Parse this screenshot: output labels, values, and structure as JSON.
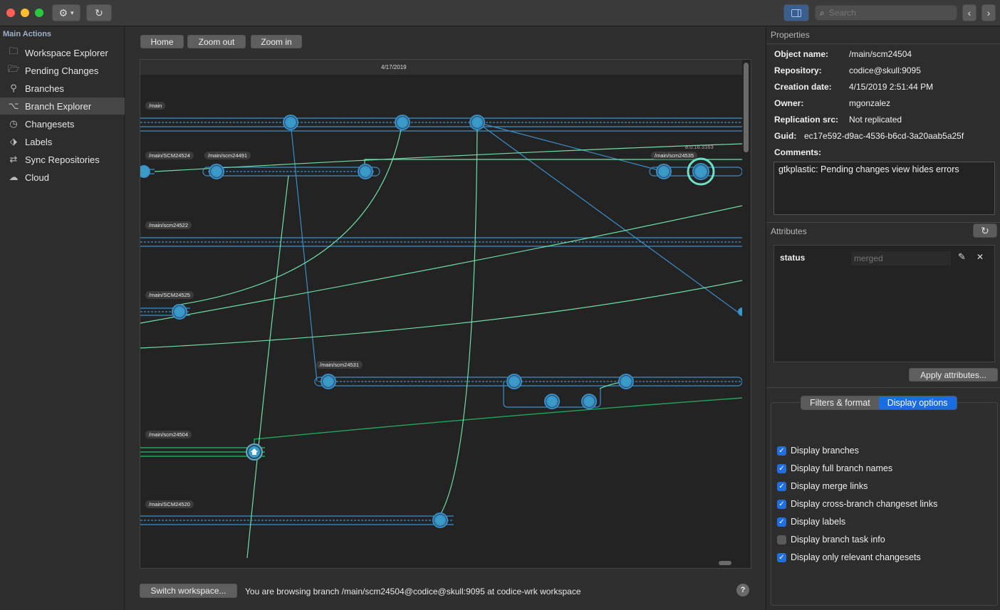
{
  "titlebar": {
    "search_placeholder": "Search",
    "gear_icon": "gear-icon",
    "refresh_icon": "refresh-icon"
  },
  "sidebar": {
    "title": "Main Actions",
    "items": [
      {
        "label": "Workspace Explorer",
        "icon": "folder-icon"
      },
      {
        "label": "Pending Changes",
        "icon": "folder-changes-icon"
      },
      {
        "label": "Branches",
        "icon": "branches-icon"
      },
      {
        "label": "Branch Explorer",
        "icon": "branch-explorer-icon",
        "selected": true
      },
      {
        "label": "Changesets",
        "icon": "history-icon"
      },
      {
        "label": "Labels",
        "icon": "tag-icon"
      },
      {
        "label": "Sync Repositories",
        "icon": "sync-icon"
      },
      {
        "label": "Cloud",
        "icon": "cloud-icon"
      }
    ]
  },
  "main": {
    "buttons": {
      "home": "Home",
      "zoom_out": "Zoom out",
      "zoom_in": "Zoom in"
    },
    "graph": {
      "date": "4/17/2019",
      "version_label": "8.0.16.3163",
      "branches": [
        "/main",
        "/main/SCM24524",
        "/main/scm24491",
        "/main/scm24535",
        "/main/scm24522",
        "/main/SCM24525",
        "/main/scm24531",
        "/main/scm24504",
        "/main/SCM24520"
      ]
    },
    "switch_button": "Switch workspace...",
    "status": "You are browsing branch /main/scm24504@codice@skull:9095 at codice-wrk workspace",
    "help": "?"
  },
  "properties": {
    "title": "Properties",
    "rows": [
      {
        "key": "Object name:",
        "value": "/main/scm24504"
      },
      {
        "key": "Repository:",
        "value": "codice@skull:9095"
      },
      {
        "key": "Creation date:",
        "value": "4/15/2019 2:51:44 PM"
      },
      {
        "key": "Owner:",
        "value": "mgonzalez"
      },
      {
        "key": "Replication src:",
        "value": "Not replicated"
      },
      {
        "key": "Guid:",
        "value": "ec17e592-d9ac-4536-b6cd-3a20aab5a25f"
      },
      {
        "key": "Comments:",
        "value": ""
      }
    ],
    "comments": "gtkplastic: Pending changes view hides errors"
  },
  "attributes": {
    "title": "Attributes",
    "name": "status",
    "value_placeholder": "merged",
    "apply_label": "Apply attributes..."
  },
  "display_options": {
    "tabs": [
      "Filters & format",
      "Display options"
    ],
    "active_tab": 1,
    "options": [
      {
        "label": "Display branches",
        "checked": true
      },
      {
        "label": "Display full branch names",
        "checked": true
      },
      {
        "label": "Display merge links",
        "checked": true
      },
      {
        "label": "Display cross-branch changeset links",
        "checked": true
      },
      {
        "label": "Display labels",
        "checked": true
      },
      {
        "label": "Display branch task info",
        "checked": false
      },
      {
        "label": "Display only relevant changesets",
        "checked": true
      }
    ]
  },
  "colors": {
    "accent": "#1a6de0",
    "branch_line": "#3b8ec7",
    "merge_link": "#6ee0a6",
    "changeset_fill": "#3a9cc6",
    "home_branch": "#1fa85a"
  }
}
